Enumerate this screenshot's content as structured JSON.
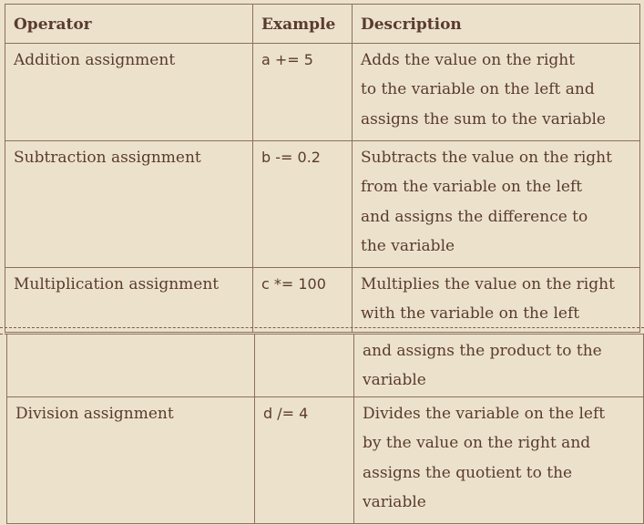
{
  "table": {
    "headers": [
      "Operator",
      "Example",
      "Description"
    ],
    "rows": [
      {
        "operator": "Addition assignment",
        "example": "a += 5",
        "desc": [
          "Adds the value on the right",
          "to the variable on the left and",
          "assigns the sum to the variable"
        ]
      },
      {
        "operator": "Subtraction assignment",
        "example": "b -= 0.2",
        "desc": [
          "Subtracts the value on the right",
          "from the variable on the left",
          "and assigns the difference to",
          "the variable"
        ]
      },
      {
        "operator": "Multiplication assignment",
        "example": "c *= 100",
        "desc": [
          "Multiplies the value on the right",
          "with the variable on the left"
        ]
      }
    ],
    "continued_rows": [
      {
        "operator": "",
        "example": "",
        "desc": [
          "and assigns the product to the",
          "variable"
        ]
      },
      {
        "operator": "Division assignment",
        "example": "d /= 4",
        "desc": [
          "Divides the variable on the left",
          "by the value on the right and",
          "assigns the quotient to the",
          "variable"
        ]
      }
    ]
  },
  "colors": {
    "background": "#ece2cc",
    "text": "#5a3b2e",
    "border": "#8c6e5e"
  }
}
